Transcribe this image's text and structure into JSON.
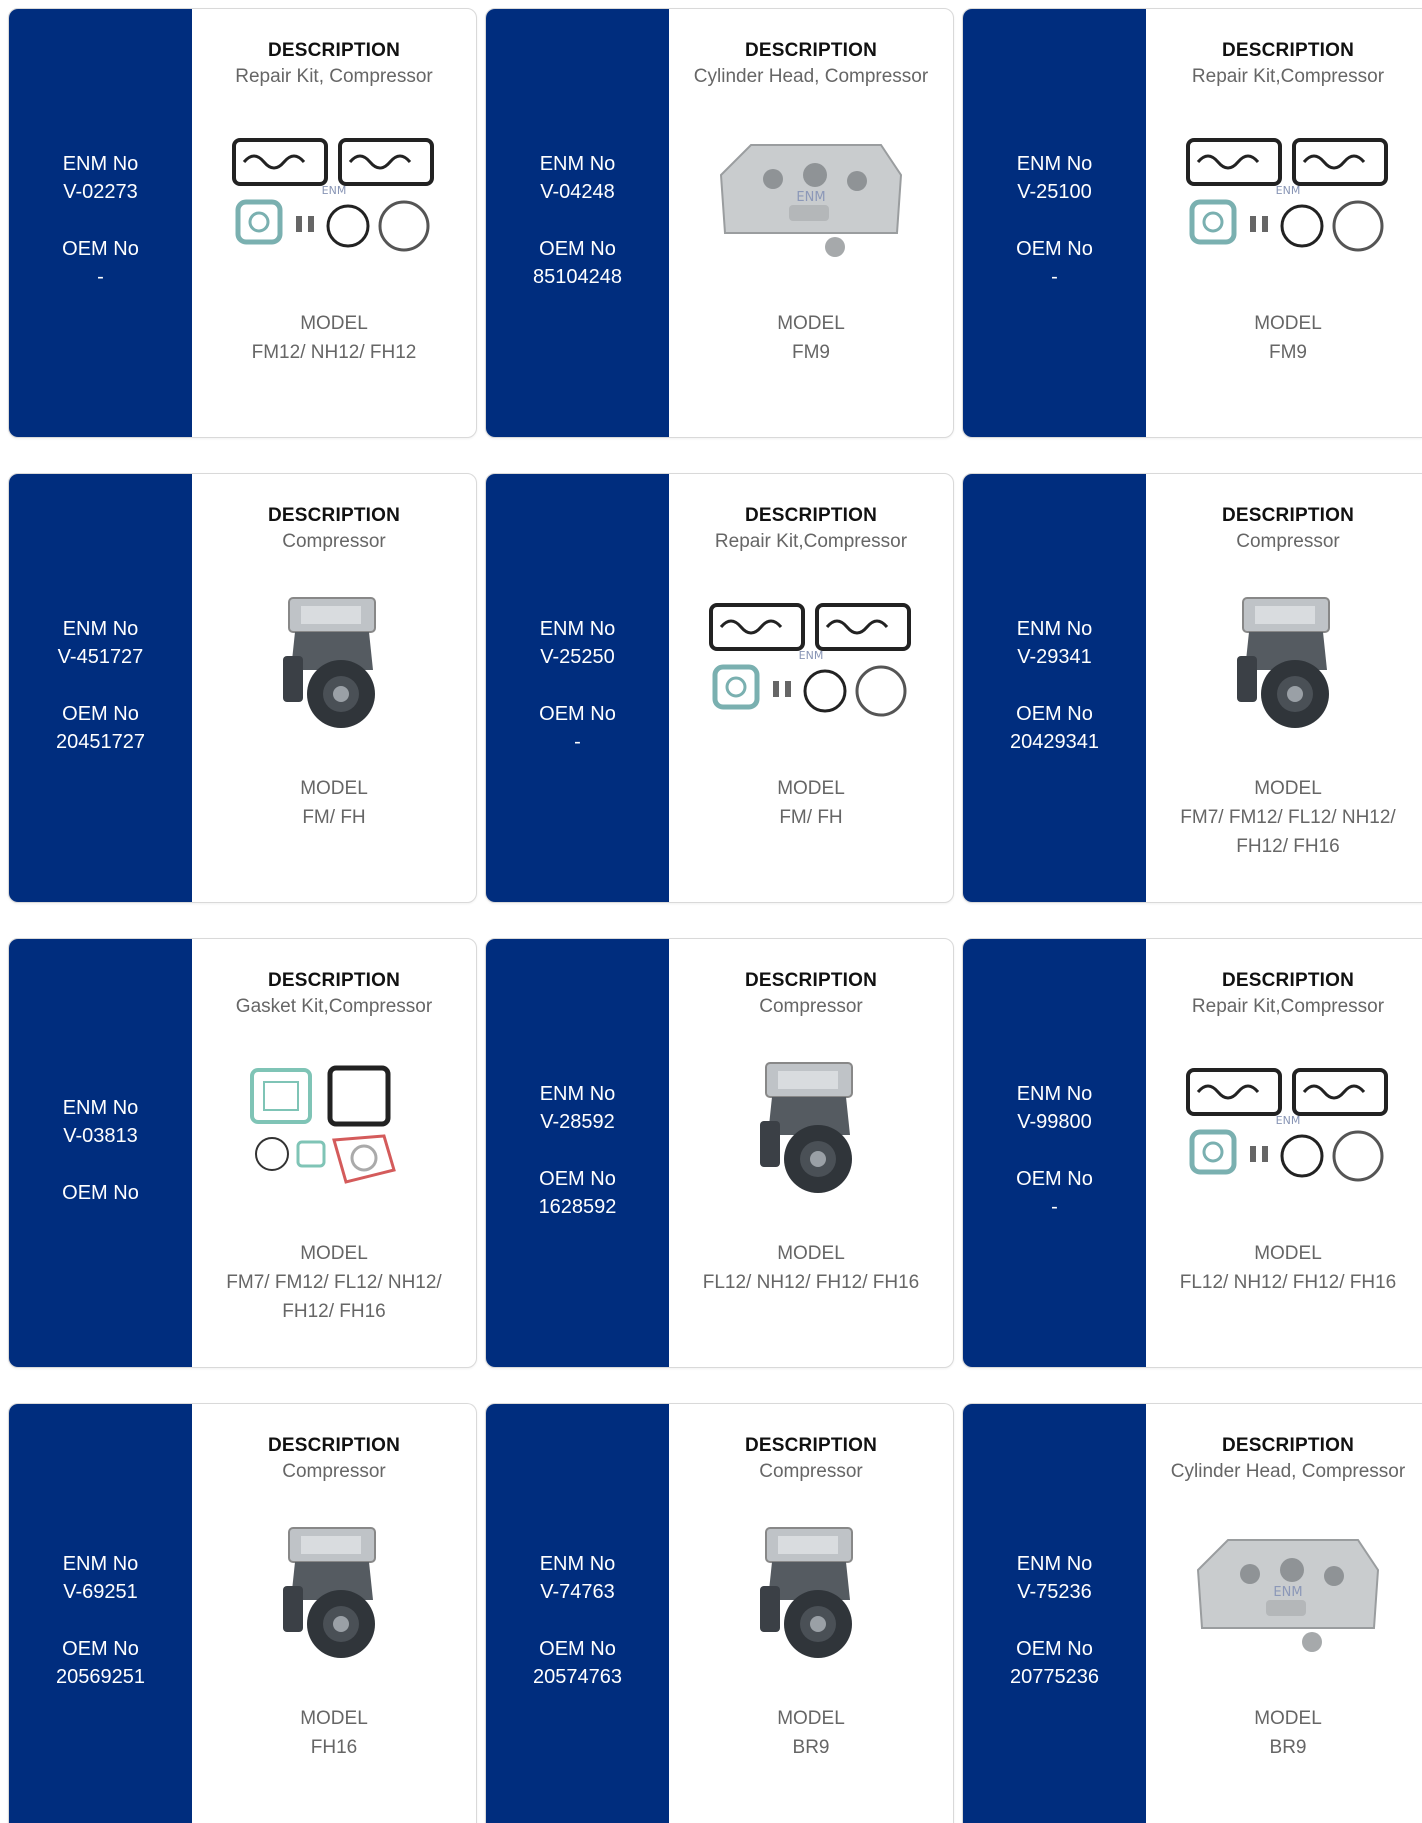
{
  "labels": {
    "enm": "ENM No",
    "oem": "OEM No",
    "description": "DESCRIPTION",
    "model": "MODEL"
  },
  "products": [
    {
      "enm": "V-02273",
      "oem": "-",
      "description": "Repair Kit, Compressor",
      "model": "FM12/ NH12/ FH12",
      "image": "repair-kit-image"
    },
    {
      "enm": "V-04248",
      "oem": "85104248",
      "description": "Cylinder Head, Compressor",
      "model": "FM9",
      "image": "cylinder-head-image"
    },
    {
      "enm": "V-25100",
      "oem": "-",
      "description": "Repair Kit,Compressor",
      "model": "FM9",
      "image": "repair-kit-image"
    },
    {
      "enm": "V-451727",
      "oem": "20451727",
      "description": "Compressor",
      "model": "FM/ FH",
      "image": "compressor-image"
    },
    {
      "enm": "V-25250",
      "oem": "-",
      "description": "Repair Kit,Compressor",
      "model": "FM/ FH",
      "image": "repair-kit-image"
    },
    {
      "enm": "V-29341",
      "oem": "20429341",
      "description": "Compressor",
      "model": "FM7/ FM12/ FL12/ NH12/ FH12/ FH16",
      "image": "compressor-image"
    },
    {
      "enm": "V-03813",
      "oem": "",
      "description": "Gasket Kit,Compressor",
      "model": "FM7/ FM12/ FL12/ NH12/ FH12/ FH16",
      "image": "gasket-kit-image"
    },
    {
      "enm": "V-28592",
      "oem": "1628592",
      "description": "Compressor",
      "model": "FL12/ NH12/ FH12/ FH16",
      "image": "compressor-image"
    },
    {
      "enm": "V-99800",
      "oem": "-",
      "description": "Repair Kit,Compressor",
      "model": "FL12/ NH12/ FH12/ FH16",
      "image": "repair-kit-image"
    },
    {
      "enm": "V-69251",
      "oem": "20569251",
      "description": "Compressor",
      "model": "FH16",
      "image": "compressor-image"
    },
    {
      "enm": "V-74763",
      "oem": "20574763",
      "description": "Compressor",
      "model": "BR9",
      "image": "compressor-image"
    },
    {
      "enm": "V-75236",
      "oem": "20775236",
      "description": "Cylinder Head, Compressor",
      "model": "BR9",
      "image": "cylinder-head-image"
    }
  ],
  "colors": {
    "sidebar": "#002d7e",
    "text_dark": "#111111",
    "text_muted": "#666666"
  }
}
